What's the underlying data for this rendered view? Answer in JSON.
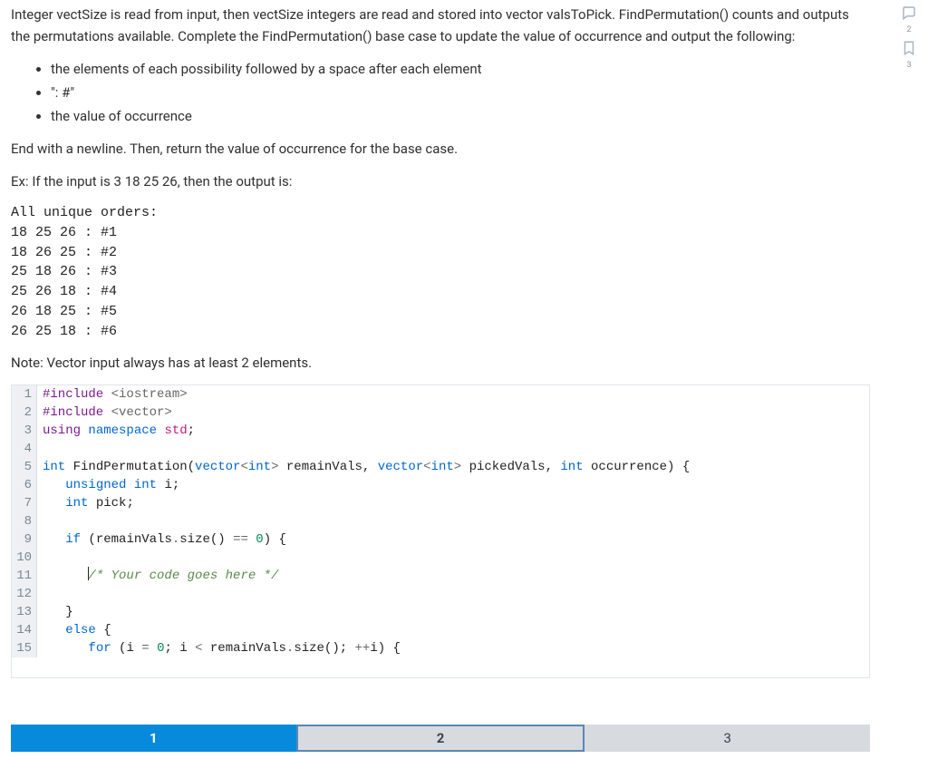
{
  "problem": {
    "intro": "Integer vectSize is read from input, then vectSize integers are read and stored into vector valsToPick. FindPermutation() counts and outputs the permutations available. Complete the FindPermutation() base case to update the value of occurrence and output the following:",
    "bullets": [
      "the elements of each possibility followed by a space after each element",
      "\": #\"",
      "the value of occurrence"
    ],
    "end_line": "End with a newline. Then, return the value of occurrence for the base case.",
    "example_prefix": "Ex: If the input is 3 18 25 26, then the output is:",
    "example_output": "All unique orders:\n18 25 26 : #1\n18 26 25 : #2\n25 18 26 : #3\n25 26 18 : #4\n26 18 25 : #5\n26 25 18 : #6",
    "note": "Note: Vector input always has at least 2 elements."
  },
  "code": {
    "lines": [
      {
        "n": "1",
        "raw": "#include <iostream>"
      },
      {
        "n": "2",
        "raw": "#include <vector>"
      },
      {
        "n": "3",
        "raw": "using namespace std;"
      },
      {
        "n": "4",
        "raw": ""
      },
      {
        "n": "5",
        "raw": "int FindPermutation(vector<int> remainVals, vector<int> pickedVals, int occurrence) {"
      },
      {
        "n": "6",
        "raw": "   unsigned int i;"
      },
      {
        "n": "7",
        "raw": "   int pick;"
      },
      {
        "n": "8",
        "raw": ""
      },
      {
        "n": "9",
        "raw": "   if (remainVals.size() == 0) {"
      },
      {
        "n": "10",
        "raw": ""
      },
      {
        "n": "11",
        "raw": "      /* Your code goes here */"
      },
      {
        "n": "12",
        "raw": ""
      },
      {
        "n": "13",
        "raw": "   }"
      },
      {
        "n": "14",
        "raw": "   else {"
      },
      {
        "n": "15",
        "raw": "      for (i = 0; i < remainVals.size(); ++i) {"
      }
    ]
  },
  "pager": {
    "p1": "1",
    "p2": "2",
    "p3": "3"
  },
  "sidebar": {
    "label_top": "2",
    "label_bottom": "3"
  }
}
